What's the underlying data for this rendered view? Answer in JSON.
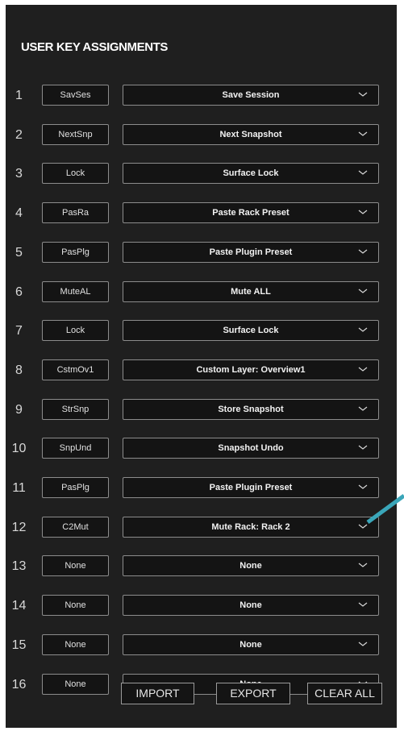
{
  "panel": {
    "title": "USER KEY ASSIGNMENTS"
  },
  "rows": [
    {
      "num": "1",
      "short": "SavSes",
      "action": "Save Session"
    },
    {
      "num": "2",
      "short": "NextSnp",
      "action": "Next Snapshot"
    },
    {
      "num": "3",
      "short": "Lock",
      "action": "Surface Lock"
    },
    {
      "num": "4",
      "short": "PasRa",
      "action": "Paste Rack Preset"
    },
    {
      "num": "5",
      "short": "PasPlg",
      "action": "Paste Plugin Preset"
    },
    {
      "num": "6",
      "short": "MuteAL",
      "action": "Mute ALL"
    },
    {
      "num": "7",
      "short": "Lock",
      "action": "Surface Lock"
    },
    {
      "num": "8",
      "short": "CstmOv1",
      "action": "Custom Layer: Overview1"
    },
    {
      "num": "9",
      "short": "StrSnp",
      "action": "Store Snapshot"
    },
    {
      "num": "10",
      "short": "SnpUnd",
      "action": "Snapshot Undo"
    },
    {
      "num": "11",
      "short": "PasPlg",
      "action": "Paste Plugin Preset"
    },
    {
      "num": "12",
      "short": "C2Mut",
      "action": "Mute Rack: Rack 2"
    },
    {
      "num": "13",
      "short": "None",
      "action": "None"
    },
    {
      "num": "14",
      "short": "None",
      "action": "None"
    },
    {
      "num": "15",
      "short": "None",
      "action": "None"
    },
    {
      "num": "16",
      "short": "None",
      "action": "None"
    }
  ],
  "buttons": {
    "import_label": "IMPORT",
    "export_label": "EXPORT",
    "clear_label": "CLEAR ALL"
  },
  "icons": {
    "dropdown": "chevron-down-icon"
  },
  "colors": {
    "panel_bg": "#1f1f1f",
    "field_bg": "#141414",
    "field_border": "#8c8c8c",
    "text": "#f2f2f2",
    "annotation_line": "#3aa6b9"
  }
}
